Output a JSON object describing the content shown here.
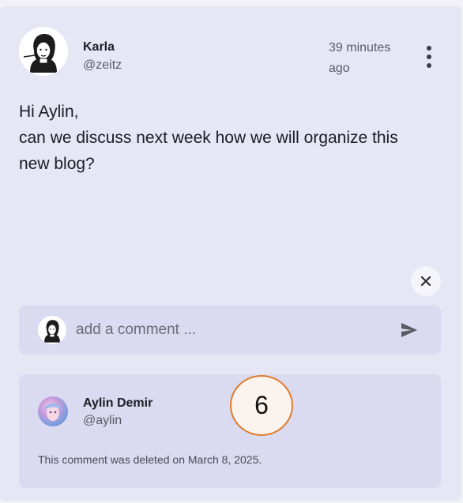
{
  "post": {
    "author_name": "Karla",
    "author_handle": "@zeitz",
    "timestamp": "39 minutes ago",
    "body_lines": [
      "Hi Aylin,",
      "can we discuss next week how we will organize this new blog?"
    ],
    "more_icon": "more-vertical-icon"
  },
  "close_icon": "close-icon",
  "comment_bar": {
    "placeholder": "add a comment ...",
    "send_icon": "send-icon"
  },
  "reply": {
    "author_name": "Aylin Demir",
    "author_handle": "@aylin",
    "deleted_note": "This comment was deleted on March 8, 2025."
  },
  "badge": {
    "label": "6"
  },
  "colors": {
    "card_bg": "#e6e6f5",
    "inner_bg": "#dadaf0",
    "badge_border": "#e07b2e"
  }
}
